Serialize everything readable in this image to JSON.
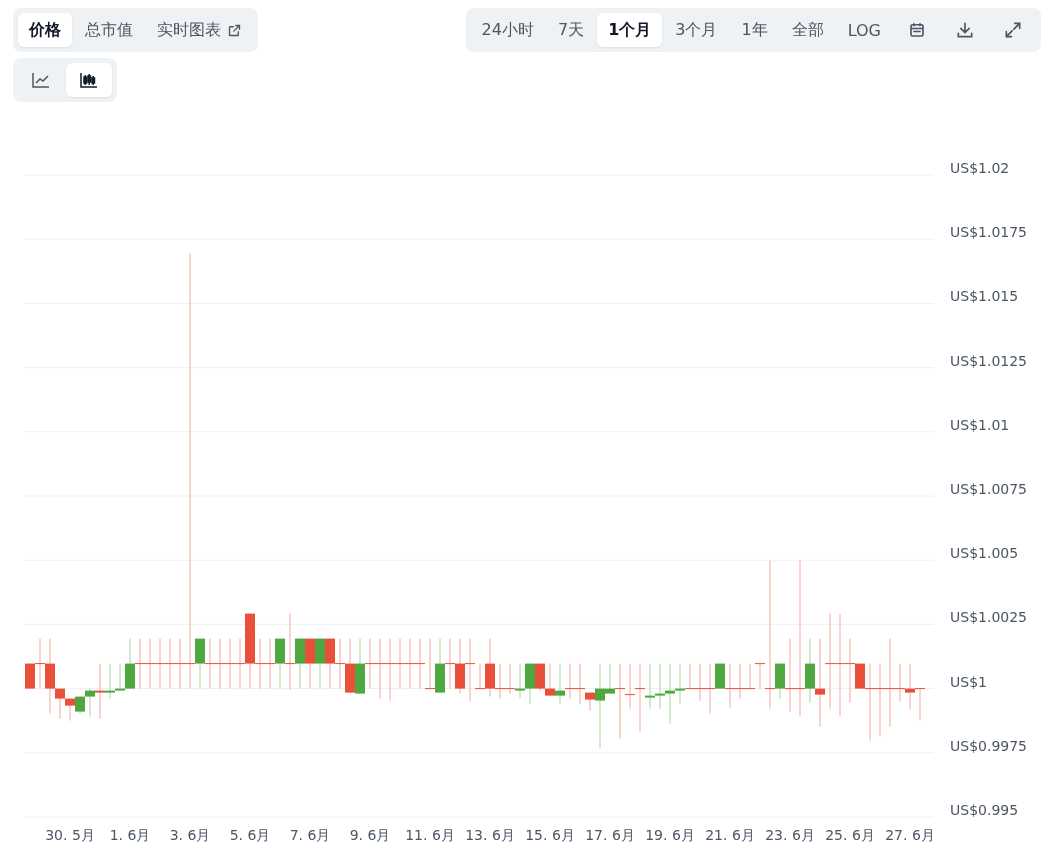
{
  "view_tabs": [
    {
      "label": "价格",
      "selected": true,
      "external_link": false
    },
    {
      "label": "总市值",
      "selected": false,
      "external_link": false
    },
    {
      "label": "实时图表",
      "selected": false,
      "external_link": true
    }
  ],
  "ranges": [
    {
      "label": "24小时",
      "selected": false
    },
    {
      "label": "7天",
      "selected": false
    },
    {
      "label": "1个月",
      "selected": true
    },
    {
      "label": "3个月",
      "selected": false
    },
    {
      "label": "1年",
      "selected": false
    },
    {
      "label": "全部",
      "selected": false
    },
    {
      "label": "LOG",
      "selected": false
    }
  ],
  "chart_types": [
    {
      "kind": "line",
      "selected": false
    },
    {
      "kind": "candlestick",
      "selected": true
    }
  ],
  "chart": {
    "y_labels": [
      "US$1.02",
      "US$1.0175",
      "US$1.015",
      "US$1.0125",
      "US$1.01",
      "US$1.0075",
      "US$1.005",
      "US$1.0025",
      "US$1",
      "US$0.9975",
      "US$0.995"
    ],
    "x_labels": [
      "30. 5月",
      "1. 6月",
      "3. 6月",
      "5. 6月",
      "7. 6月",
      "9. 6月",
      "11. 6月",
      "13. 6月",
      "15. 6月",
      "17. 6月",
      "19. 6月",
      "21. 6月",
      "23. 6月",
      "25. 6月",
      "27. 6月"
    ]
  }
}
